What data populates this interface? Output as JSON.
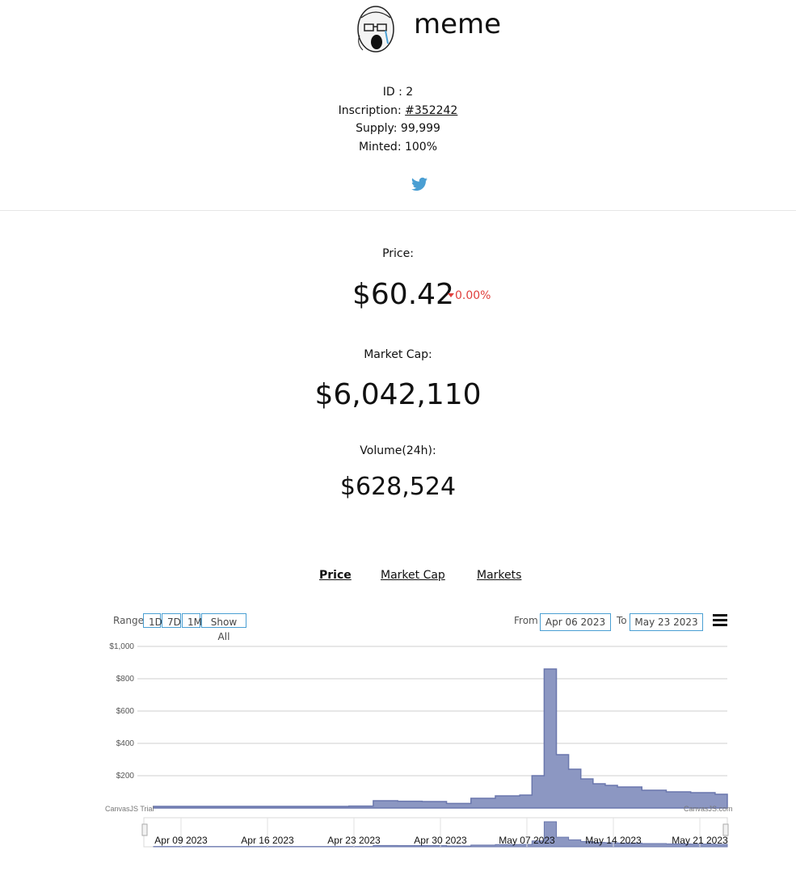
{
  "token": {
    "name": "meme",
    "id_text": "ID : 2",
    "inscription_label": "Inscription: ",
    "inscription_link": "#352242",
    "supply_text": "Supply: 99,999",
    "minted_text": "Minted: 100%",
    "twitter_icon": "twitter-icon"
  },
  "stats": {
    "price_label": "Price:",
    "price_value": "$60.42",
    "price_change": "0.00%",
    "market_cap_label": "Market Cap:",
    "market_cap_value": "$6,042,110",
    "volume_label": "Volume(24h):",
    "volume_value": "$628,524",
    "change_color": "#e0403d"
  },
  "tabs": [
    {
      "label": "Price",
      "active": true
    },
    {
      "label": "Market Cap",
      "active": false
    },
    {
      "label": "Markets",
      "active": false
    }
  ],
  "range_selector": {
    "label": "Range",
    "buttons": [
      "1D",
      "7D",
      "1M",
      "Show All"
    ],
    "from_label": "From",
    "from_value": "Apr 06 2023",
    "to_label": "To",
    "to_value": "May 23 2023",
    "menu_icon": "hamburger-menu-icon"
  },
  "chart_data": {
    "type": "area",
    "ylim": [
      0,
      1000
    ],
    "yticks": [
      "$1,000",
      "$800",
      "$600",
      "$400",
      "$200"
    ],
    "navigator_xticks": [
      "Apr 09 2023",
      "Apr 16 2023",
      "Apr 23 2023",
      "Apr 30 2023",
      "May 07 2023",
      "May 14 2023",
      "May 21 2023"
    ],
    "watermark_left": "CanvasJS Trial",
    "watermark_right": "CanvasJS.com",
    "fill_color": "#8c97c2",
    "line_color": "#6a77ad",
    "series": [
      {
        "x": [
          "2023-04-06",
          "2023-04-10",
          "2023-04-14",
          "2023-04-18",
          "2023-04-22",
          "2023-04-24",
          "2023-04-26",
          "2023-04-28",
          "2023-04-30",
          "2023-05-02",
          "2023-05-04",
          "2023-05-06",
          "2023-05-07",
          "2023-05-08",
          "2023-05-09",
          "2023-05-10",
          "2023-05-11",
          "2023-05-12",
          "2023-05-13",
          "2023-05-14",
          "2023-05-16",
          "2023-05-18",
          "2023-05-20",
          "2023-05-22",
          "2023-05-23"
        ],
        "y": [
          10,
          10,
          10,
          10,
          12,
          45,
          42,
          40,
          28,
          60,
          75,
          80,
          200,
          860,
          330,
          240,
          180,
          150,
          140,
          130,
          110,
          100,
          95,
          85,
          70
        ]
      }
    ]
  }
}
